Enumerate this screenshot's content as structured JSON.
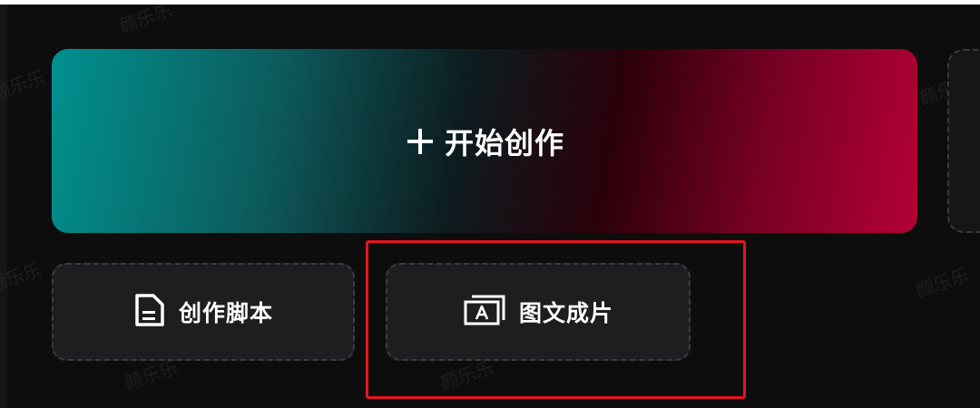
{
  "start_create": {
    "label": "开始创作",
    "icon": "plus-icon",
    "gradient_colors": [
      "#00918f",
      "#0d1c1f",
      "#b40036"
    ]
  },
  "tools": [
    {
      "label": "创作脚本",
      "icon": "document-icon"
    },
    {
      "label": "图文成片",
      "icon": "image-text-icon"
    }
  ],
  "highlight": {
    "color": "#e8141c"
  },
  "watermark": {
    "text": "颜乐乐"
  }
}
